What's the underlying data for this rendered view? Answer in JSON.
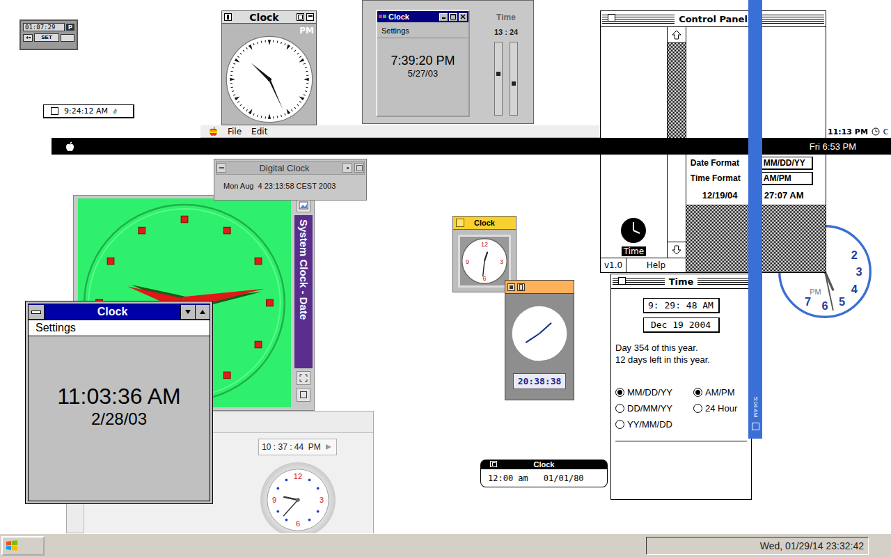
{
  "mini_watch": {
    "time": "01:07:29",
    "meridiem": "P",
    "button": "SET"
  },
  "strip_clock": {
    "time": "9:24:12 AM",
    "glyph": "∂"
  },
  "analog_window": {
    "title": "Clock",
    "meridiem": "PM",
    "hands": {
      "hour": 10.4,
      "minute": 26
    }
  },
  "win95_clock": {
    "title": "Clock",
    "menu": "Settings",
    "time": "7:39:20 PM",
    "date": "5/27/03"
  },
  "slider_panel": {
    "title": "Time",
    "reading": "13 : 24",
    "sliders": [
      {
        "name": "hours",
        "level": 0.58
      },
      {
        "name": "minutes",
        "level": 0.44
      }
    ]
  },
  "mac_menubar": {
    "items": [
      "File",
      "Edit"
    ]
  },
  "black_menubar": {
    "clock": "Fri 6:53 PM"
  },
  "edge_menubar": {
    "clock": "11:13 PM",
    "tail": "C"
  },
  "control_panel": {
    "title": "Control Panel",
    "icon_label": "Time",
    "icon_selected": true,
    "version": "v1.0",
    "help": "Help",
    "date_format_label": "Date Format",
    "date_format": "MM/DD/YY",
    "time_format_label": "Time Format",
    "time_format": "AM/PM",
    "date": "12/19/04",
    "time": "27:07 AM"
  },
  "side_bar": {
    "clock": "5:04 AM"
  },
  "time_window": {
    "title": "Time",
    "time": "9: 29: 48 AM",
    "date": "Dec 19 2004",
    "lines": [
      "Day 354 of this year.",
      "12 days left in this year."
    ],
    "date_formats": [
      {
        "label": "MM/DD/YY",
        "selected": true
      },
      {
        "label": "DD/MM/YY",
        "selected": false
      },
      {
        "label": "YY/MM/DD",
        "selected": false
      }
    ],
    "time_formats": [
      {
        "label": "AM/PM",
        "selected": true
      },
      {
        "label": "24 Hour",
        "selected": false
      }
    ]
  },
  "blue_clock": {
    "numerals": [
      "2",
      "3",
      "4",
      "5",
      "6",
      "7"
    ],
    "meridiem": "PM",
    "hands": {
      "hour": 5.2,
      "minute": 28
    }
  },
  "digital_clock": {
    "title": "Digital Clock",
    "text": "Mon Aug  4 23:13:58 CEST 2003"
  },
  "green_clock": {
    "side_label": "System Clock - Date",
    "hands": {
      "hour": 9.55,
      "minute": 13.3
    }
  },
  "win31_clock": {
    "title": "Clock",
    "menu": "Settings",
    "time": "11:03:36 AM",
    "date": "2/28/03"
  },
  "grey_panel": {
    "time": "10 : 37 : 44  PM",
    "numerals": [
      "12",
      "3",
      "6",
      "9"
    ],
    "hands": {
      "hour": 9.4,
      "minute": 37
    }
  },
  "yellow_clock": {
    "title": "Clock",
    "numerals": [
      "12",
      "3",
      "6",
      "9"
    ],
    "hands": {
      "hour": 0.6,
      "minute": 31
    }
  },
  "orange_clock": {
    "time": "20:38:38",
    "hands": {
      "minute": 8
    }
  },
  "pill_clock": {
    "title": "Clock",
    "time": "12:00 am",
    "date": "01/01/80"
  },
  "taskbar": {
    "clock": "Wed, 01/29/14 23:32:42"
  }
}
